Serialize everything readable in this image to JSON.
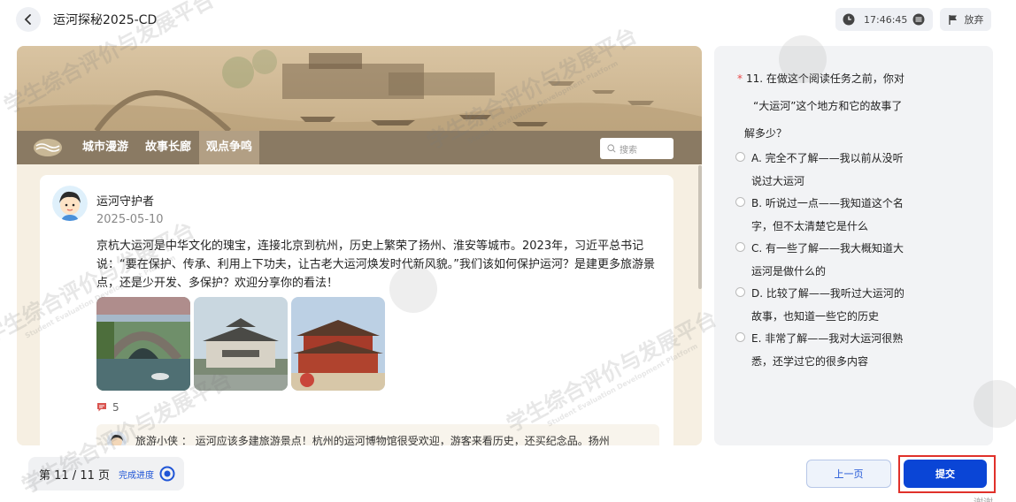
{
  "header": {
    "title": "运河探秘2025-CD",
    "timer": "17:46:45",
    "give_up_label": "放弃"
  },
  "nav": {
    "tabs": [
      {
        "label": "城市漫游"
      },
      {
        "label": "故事长廊"
      },
      {
        "label": "观点争鸣",
        "active": true
      }
    ],
    "search_placeholder": "搜索"
  },
  "post": {
    "author": "运河守护者",
    "date": "2025-05-10",
    "text": "京杭大运河是中华文化的瑰宝，连接北京到杭州，历史上繁荣了扬州、淮安等城市。2023年，习近平总书记说：“要在保护、传承、利用上下功夫，让古老大运河焕发时代新风貌。”我们该如何保护运河？是建更多旅游景点，还是少开发、多保护？欢迎分享你的看法！",
    "comment_count": "5",
    "reply": {
      "author": "旅游小侠",
      "separator": "：",
      "text": "运河应该多建旅游景点！杭州的运河博物馆很受欢迎，游客来看历史，还买纪念品。扬州"
    }
  },
  "question": {
    "required_mark": "*",
    "stem_lines": [
      "11. 在做这个阅读任务之前，你对",
      "“大运河”这个地方和它的故事了",
      "解多少？"
    ],
    "options": [
      {
        "lines": [
          "A. 完全不了解——我以前从没听",
          "说过大运河"
        ]
      },
      {
        "lines": [
          "B. 听说过一点——我知道这个名",
          "字，但不太清楚它是什么"
        ]
      },
      {
        "lines": [
          "C. 有一些了解——我大概知道大",
          "运河是做什么的"
        ]
      },
      {
        "lines": [
          "D. 比较了解——我听过大运河的",
          "故事，也知道一些它的历史"
        ]
      },
      {
        "lines": [
          "E. 非常了解——我对大运河很熟",
          "悉，还学过它的很多内容"
        ]
      }
    ]
  },
  "footer": {
    "page_indicator": "第 11 / 11 页",
    "progress_label": "完成进度",
    "prev_label": "上一页",
    "submit_label": "提交",
    "corner_text": "谢谢"
  },
  "watermark": {
    "text": "学生综合评价与发展平台",
    "subtext": "Student Evaluation Development Platform"
  },
  "colors": {
    "accent": "#0a45d6",
    "nav_bg": "#8a7a63",
    "nav_active": "#b29f84",
    "content_bg": "#f6efe2",
    "highlight_border": "#e0312a"
  }
}
